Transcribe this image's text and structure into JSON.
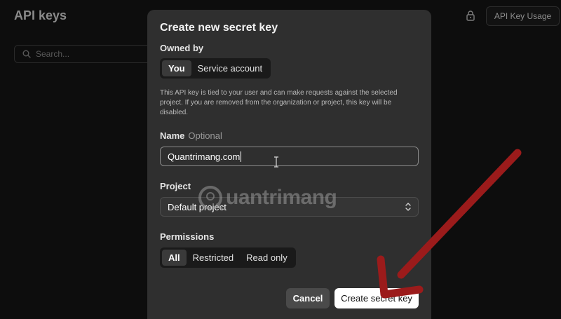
{
  "background": {
    "page_title": "API keys",
    "search_placeholder": "Search...",
    "usage_button": "API Key Usage"
  },
  "modal": {
    "title": "Create new secret key",
    "owned_by_label": "Owned by",
    "owner_options": [
      "You",
      "Service account"
    ],
    "owner_selected": "You",
    "description": "This API key is tied to your user and can make requests against the selected project. If you are removed from the organization or project, this key will be disabled.",
    "name_label": "Name",
    "name_optional": "Optional",
    "name_value": "Quantrimang.com",
    "project_label": "Project",
    "project_value": "Default project",
    "permissions_label": "Permissions",
    "permission_options": [
      "All",
      "Restricted",
      "Read only"
    ],
    "permission_selected": "All",
    "cancel_label": "Cancel",
    "create_label": "Create secret key"
  },
  "watermark": {
    "text": "uantrimang"
  },
  "colors": {
    "annotation_arrow": "#9b1b1b",
    "modal_bg": "#2f2f2f",
    "page_bg": "#0d0d0d"
  }
}
